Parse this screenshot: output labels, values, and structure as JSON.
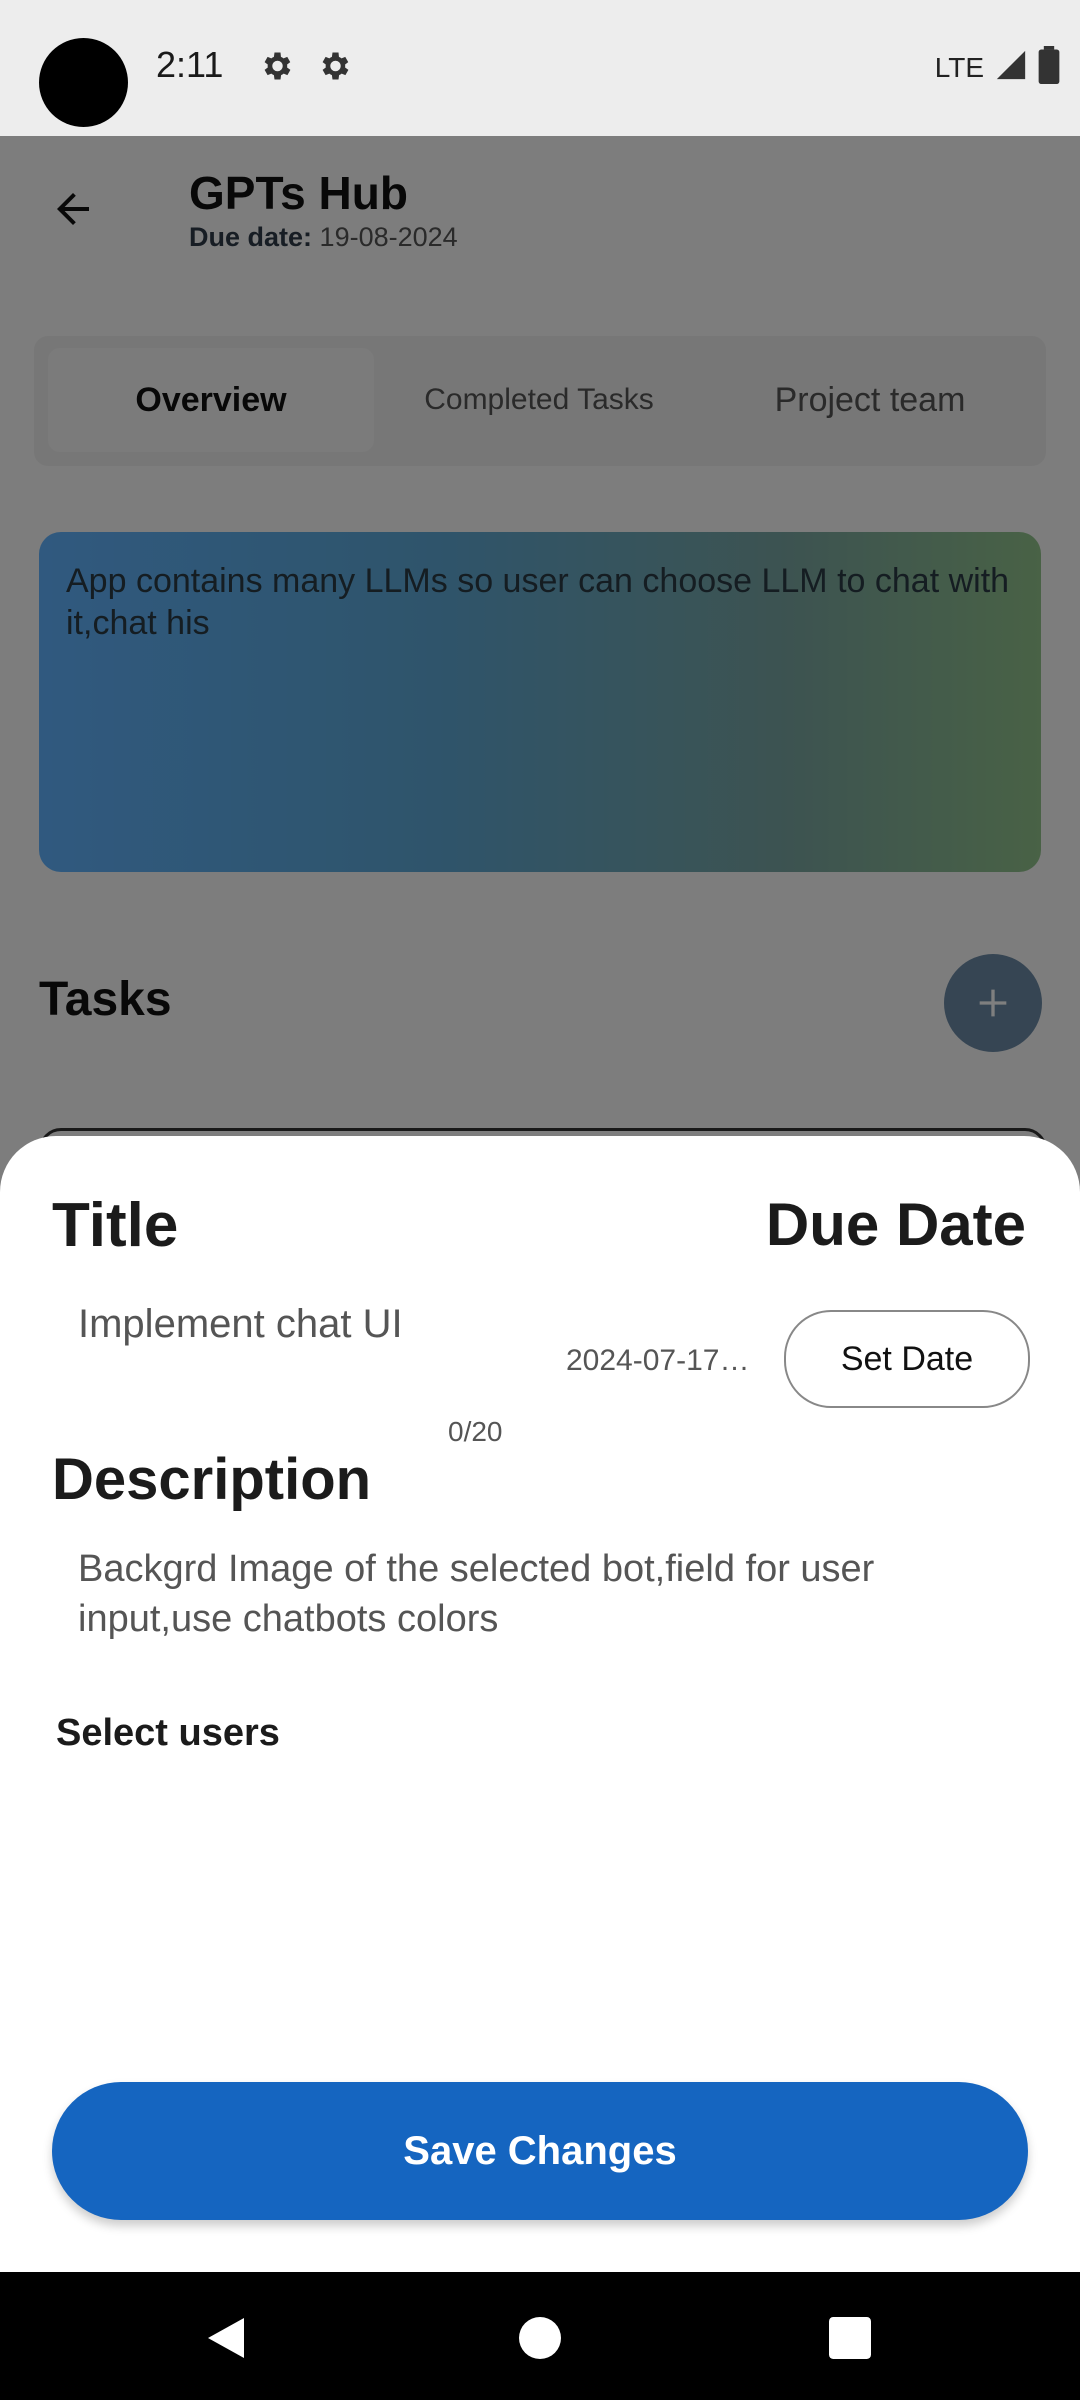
{
  "status_bar": {
    "time": "2:11",
    "network": "LTE",
    "icons": [
      "settings-icon",
      "settings-icon",
      "signal-icon",
      "battery-icon"
    ]
  },
  "header": {
    "back_icon": "arrow-left-icon",
    "title": "GPTs Hub",
    "due_label": "Due date:",
    "due_value": "19-08-2024"
  },
  "tabs": [
    {
      "label": "Overview",
      "selected": true
    },
    {
      "label": "Completed Tasks",
      "selected": false
    },
    {
      "label": "Project team",
      "selected": false
    }
  ],
  "project_description": "App contains many LLMs so user can choose LLM to chat with it,chat his",
  "tasks_section": {
    "heading": "Tasks",
    "add_icon": "plus-icon"
  },
  "sheet": {
    "title_label": "Title",
    "due_date_label": "Due Date",
    "title_value": "Implement chat UI",
    "date_value": "2024-07-17 …",
    "set_date_label": "Set Date",
    "char_counter": "0/20",
    "description_label": "Description",
    "description_value": "Backgrd Image of the selected bot,field for user input,use chatbots colors",
    "select_users_label": "Select users",
    "save_label": "Save Changes"
  },
  "colors": {
    "primary": "#1565c0",
    "gradient_start": "#60b3ff",
    "gradient_end": "#92c48c"
  },
  "nav_bar": {
    "icons": [
      "back-triangle-icon",
      "home-circle-icon",
      "recents-square-icon"
    ]
  }
}
